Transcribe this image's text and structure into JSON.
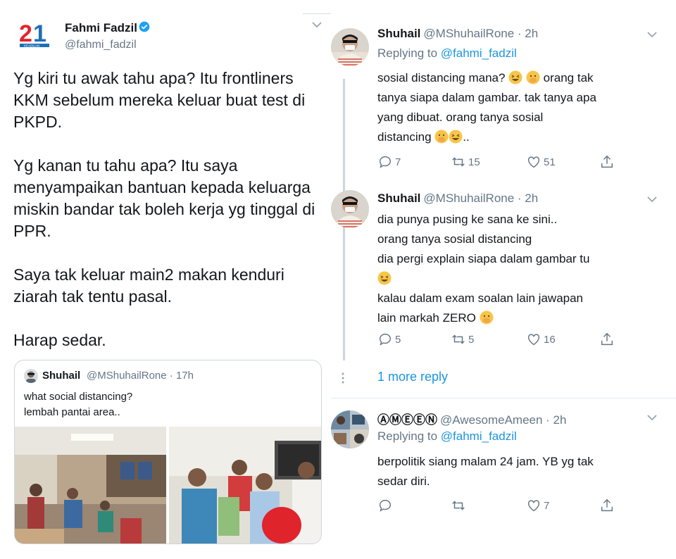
{
  "left": {
    "author": {
      "name": "Fahmi Fadzil",
      "handle": "@fahmi_fadzil",
      "logo_label": "21",
      "logo_sub": "KEADILAN"
    },
    "paragraphs": [
      "Yg kiri tu awak tahu apa? Itu frontliners KKM sebelum mereka keluar buat test di PKPD.",
      "Yg kanan tu tahu apa? Itu saya menyampaikan bantuan kepada keluarga miskin bandar tak boleh kerja yg tinggal di PPR.",
      "Saya tak keluar main2 makan kenduri ziarah tak tentu pasal.",
      "Harap sedar."
    ],
    "quote": {
      "name": "Shuhail",
      "handle": "@MShuhailRone · 17h",
      "line1": "what social distancing?",
      "line2": "lembah pantai area.."
    }
  },
  "right": {
    "replies": [
      {
        "name": "Shuhail",
        "handle": "@MShuhailRone · 2h",
        "replying_prefix": "Replying to ",
        "replying_to": "@fahmi_fadzil",
        "lines": [
          "sosial distancing mana?",
          "orang tak",
          "tanya siapa dalam gambar. tak tanya apa",
          "yang dibuat. orang tanya sosial",
          "distancing",
          ".."
        ],
        "replies": "7",
        "retweets": "15",
        "likes": "51"
      },
      {
        "name": "Shuhail",
        "handle": "@MShuhailRone · 2h",
        "lines": [
          "dia punya pusing ke sana ke sini..",
          "orang tanya sosial distancing",
          "dia pergi explain siapa dalam gambar tu",
          "kalau dalam exam soalan lain jawapan",
          "lain markah ZERO"
        ],
        "replies": "5",
        "retweets": "5",
        "likes": "16"
      },
      {
        "name": "ⒶⓂⒺⒺⓃ",
        "handle": "@AwesomeAmeen · 2h",
        "replying_prefix": "Replying to ",
        "replying_to": "@fahmi_fadzil",
        "lines": [
          "berpolitik siang malam 24 jam. YB yg tak",
          "sedar diri."
        ],
        "replies": "",
        "retweets": "",
        "likes": "7"
      }
    ],
    "more_reply": "1 more reply"
  },
  "colors": {
    "accent": "#1b95e0",
    "muted": "#657786",
    "border": "#e6ecf0",
    "text": "#14171a"
  }
}
